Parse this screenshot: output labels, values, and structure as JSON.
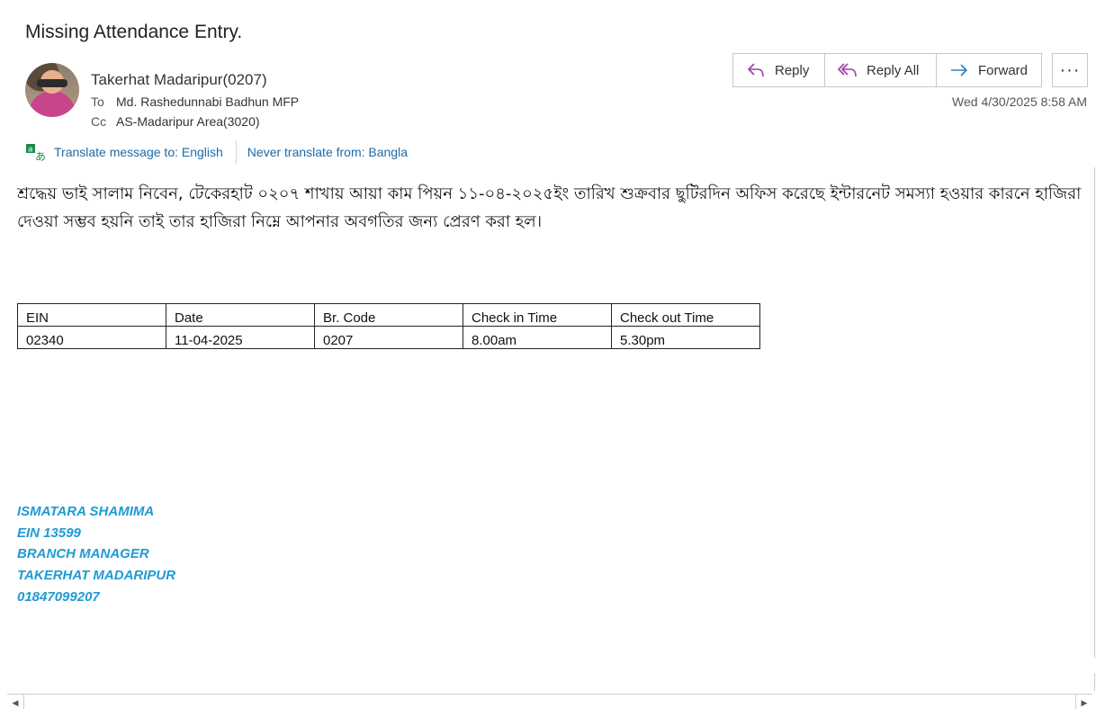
{
  "email": {
    "subject": "Missing Attendance Entry.",
    "sender": "Takerhat Madaripur(0207)",
    "to_label": "To",
    "to": "Md. Rashedunnabi Badhun MFP",
    "cc_label": "Cc",
    "cc": "AS-Madaripur Area(3020)",
    "date": "Wed 4/30/2025 8:58 AM"
  },
  "actions": {
    "reply": "Reply",
    "reply_all": "Reply All",
    "forward": "Forward",
    "more": "···"
  },
  "translate": {
    "translate_label": "Translate message to: English",
    "never_label": "Never translate from: Bangla"
  },
  "body": {
    "text": "শ্রদ্ধেয় ভাই সালাম নিবেন, টেকেরহাট ০২০৭ শাখায় আয়া কাম পিয়ন ১১-০৪-২০২৫ইং তারিখ শুক্রবার ছুটিরদিন অফিস করেছে ইন্টারনেট সমস্যা হওয়ার কারনে হাজিরা দেওয়া সম্ভব হয়নি তাই তার হাজিরা নিম্নে আপনার অবগতির জন্য প্রেরণ করা হল।"
  },
  "table": {
    "headers": [
      "EIN",
      "Date",
      "Br. Code",
      "Check in Time",
      "Check out Time"
    ],
    "rows": [
      [
        "02340",
        "11-04-2025",
        "0207",
        "8.00am",
        "5.30pm"
      ]
    ]
  },
  "signature": {
    "name": "ISMATARA SHAMIMA",
    "ein": "EIN 13599",
    "title": "BRANCH MANAGER",
    "branch": "TAKERHAT MADARIPUR",
    "phone": "01847099207"
  },
  "colors": {
    "link": "#1e6aa7",
    "signature": "#1e9bd3",
    "icon_purple": "#9b3fa3",
    "icon_blue": "#2f7fc1"
  }
}
